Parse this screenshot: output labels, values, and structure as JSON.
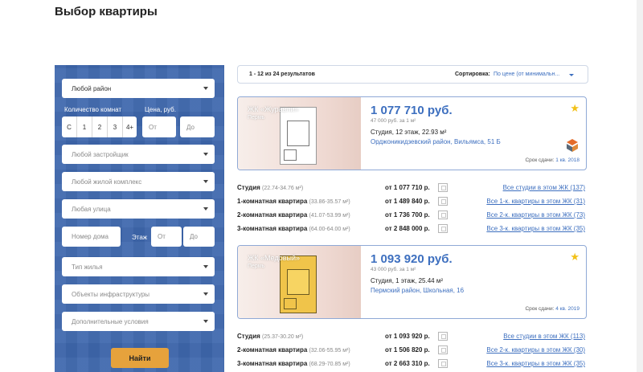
{
  "page": {
    "title": "Выбор квартиры"
  },
  "filters": {
    "district": "Любой район",
    "rooms_label": "Количество комнат",
    "price_label": "Цена, руб.",
    "rooms": [
      "С",
      "1",
      "2",
      "3",
      "4+"
    ],
    "price_from_placeholder": "От",
    "price_to_placeholder": "До",
    "developer": "Любой застройщик",
    "complex": "Любой жилой комплекс",
    "street": "Любая улица",
    "house_placeholder": "Номер дома",
    "floor_label": "Этаж",
    "floor_from_placeholder": "От",
    "floor_to_placeholder": "До",
    "housing_type": "Тип жилья",
    "infrastructure": "Объекты инфраструктуры",
    "extra": "Дополнительные условия",
    "search_button": "Найти"
  },
  "results": {
    "count_text": "1 - 12 из 24 результатов",
    "sort_label": "Сортировка:",
    "sort_value": "По цене (от минимальн..."
  },
  "cards": [
    {
      "complex_name": "ЖК «Журавли»",
      "city": "Пермь",
      "price": "1 077 710 руб.",
      "price_per_m2": "47 000 руб. за 1 м²",
      "spec": "Студия, 12 этаж, 22.93 м²",
      "address": "Орджоникидзевский район, Вильямса, 51 Б",
      "deadline_label": "Срок сдачи:",
      "deadline_value": "1 кв. 2018",
      "rows": [
        {
          "name": "Студия",
          "area": "(22.74-34.76 м²)",
          "from": "от 1 077 710 р.",
          "link": "Все студии в этом ЖК (137)"
        },
        {
          "name": "1-комнатная квартира",
          "area": "(33.86-35.57 м²)",
          "from": "от 1 489 840 р.",
          "link": "Все 1-к. квартиры в этом ЖК (31)"
        },
        {
          "name": "2-комнатная квартира",
          "area": "(41.07-53.99 м²)",
          "from": "от 1 736 700 р.",
          "link": "Все 2-к. квартиры в этом ЖК (73)"
        },
        {
          "name": "3-комнатная квартира",
          "area": "(64.00-64.00 м²)",
          "from": "от 2 848 000 р.",
          "link": "Все 3-к. квартиры в этом ЖК (35)"
        }
      ]
    },
    {
      "complex_name": "ЖК «Медовый»",
      "city": "Пермь",
      "price": "1 093 920 руб.",
      "price_per_m2": "43 000 руб. за 1 м²",
      "spec": "Студия, 1 этаж, 25.44 м²",
      "address": "Пермский район, Школьная, 16",
      "deadline_label": "Срок сдачи:",
      "deadline_value": "4 кв. 2019",
      "rows": [
        {
          "name": "Студия",
          "area": "(25.37-30.20 м²)",
          "from": "от 1 093 920 р.",
          "link": "Все студии в этом ЖК (113)"
        },
        {
          "name": "2-комнатная квартира",
          "area": "(32.06-55.95 м²)",
          "from": "от 1 506 820 р.",
          "link": "Все 2-к. квартиры в этом ЖК (30)"
        },
        {
          "name": "3-комнатная квартира",
          "area": "(68.29-70.85 м²)",
          "from": "от 2 663 310 р.",
          "link": "Все 3-к. квартиры в этом ЖК (35)"
        }
      ]
    }
  ],
  "colors": {
    "panel": "#3e67ad",
    "accent": "#3d6fbf",
    "button": "#e6a23c",
    "star": "#f2c118"
  }
}
